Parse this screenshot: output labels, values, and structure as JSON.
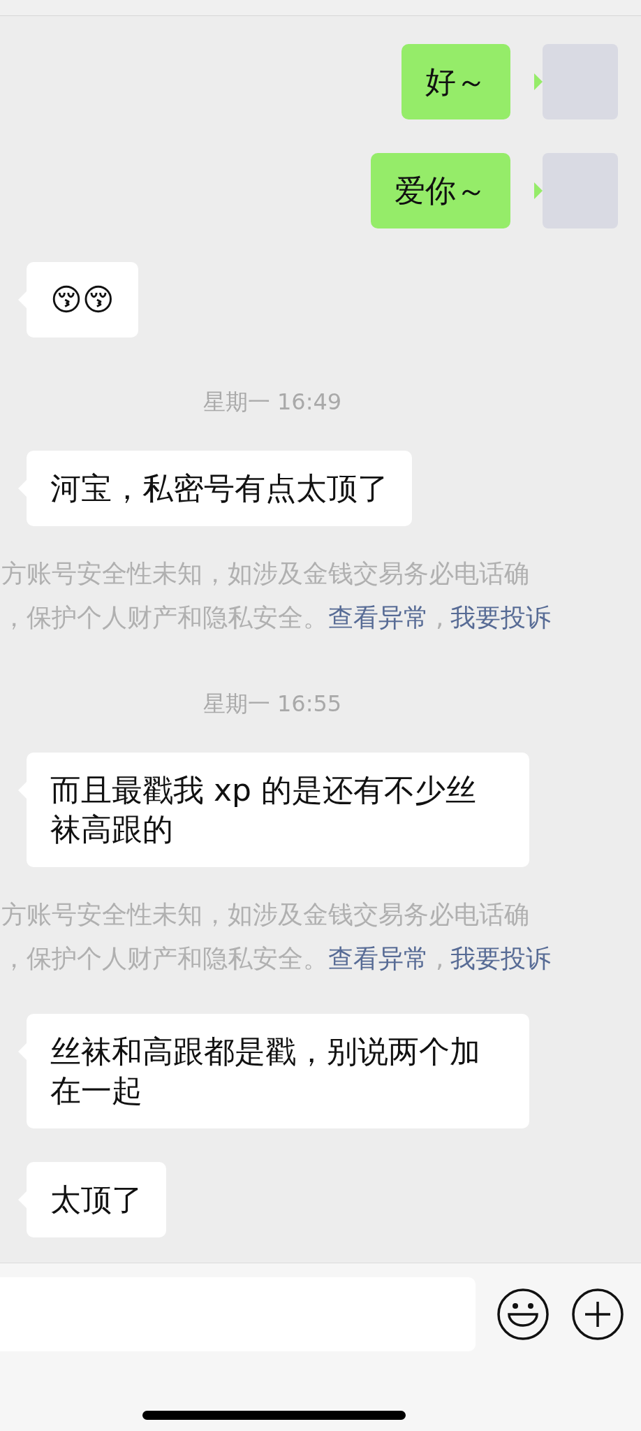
{
  "messages": [
    {
      "kind": "outgoing",
      "text": "好～"
    },
    {
      "kind": "outgoing",
      "text": "爱你～"
    },
    {
      "kind": "incoming",
      "text": "😚😚"
    },
    {
      "kind": "timestamp",
      "text": "星期一 16:49"
    },
    {
      "kind": "incoming",
      "text": "河宝，私密号有点太顶了"
    },
    {
      "kind": "warning",
      "line_1": "方账号安全性未知，如涉及金钱交易务必电话确",
      "line_2": "，保护个人财产和隐私安全。",
      "links": [
        "查看异常",
        "我要投诉"
      ],
      "separator": ","
    },
    {
      "kind": "timestamp",
      "text": "星期一 16:55"
    },
    {
      "kind": "incoming",
      "text": "而且最戳我 xp 的是还有不少丝袜高跟的"
    },
    {
      "kind": "warning",
      "line_1": "方账号安全性未知，如涉及金钱交易务必电话确",
      "line_2": "，保护个人财产和隐私安全。",
      "links": [
        "查看异常",
        "我要投诉"
      ],
      "separator": ","
    },
    {
      "kind": "incoming",
      "text": "丝袜和高跟都是戳，别说两个加在一起"
    },
    {
      "kind": "incoming",
      "text": "太顶了"
    }
  ]
}
